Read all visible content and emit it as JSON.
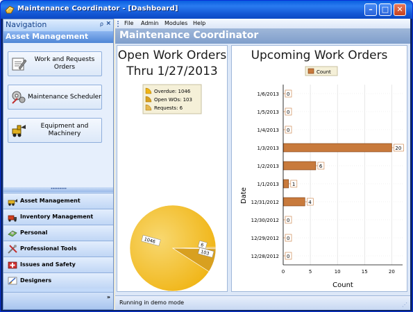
{
  "window": {
    "title": "Maintenance Coordinator - [Dashboard]",
    "minimize_glyph": "–",
    "maximize_glyph": "□",
    "close_glyph": "✕"
  },
  "nav": {
    "title": "Navigation",
    "pin_glyph": "⍴",
    "close_glyph": "×",
    "group_title": "Asset Management",
    "buttons": [
      {
        "label": "Work and Requests Orders",
        "icon": "work-orders-icon"
      },
      {
        "label": "Maintenance Scheduler",
        "icon": "scheduler-icon"
      },
      {
        "label": "Equipment and Machinery",
        "icon": "equipment-icon"
      }
    ],
    "splitter_glyph": "•••••••••",
    "items": [
      {
        "label": "Asset Management",
        "icon": "asset-icon"
      },
      {
        "label": "Inventory Management",
        "icon": "inventory-icon"
      },
      {
        "label": "Personal",
        "icon": "personal-icon"
      },
      {
        "label": "Professional Tools",
        "icon": "tools-icon"
      },
      {
        "label": "Issues and Safety",
        "icon": "safety-icon"
      },
      {
        "label": "Designers",
        "icon": "designers-icon"
      }
    ],
    "footer_chevron": "»"
  },
  "menu": {
    "file": "File",
    "admin": "Admin",
    "modules": "Modules",
    "help": "Help"
  },
  "header": {
    "title": "Maintenance Coordinator"
  },
  "status": {
    "text": "Running in demo mode"
  },
  "colors": {
    "pie_main": "#f0b414",
    "bar_fill": "#c87a3c",
    "accent": "#0a5fe0"
  },
  "chart_data": [
    {
      "type": "pie",
      "title": "Open Work Orders",
      "subtitle": "Thru 1/27/2013",
      "legend": [
        "Overdue: 1046",
        "Open WOs: 103",
        "Requests: 6"
      ],
      "legend_placement": "top",
      "categories": [
        "Overdue",
        "Open WOs",
        "Requests"
      ],
      "values": [
        1046,
        103,
        6
      ],
      "data_labels": [
        "1046",
        "103",
        "6"
      ]
    },
    {
      "type": "bar",
      "orientation": "horizontal",
      "title": "Upcoming Work Orders",
      "legend": [
        "Count"
      ],
      "legend_placement": "top",
      "xlabel": "Count",
      "ylabel": "Date",
      "categories": [
        "1/6/2013",
        "1/5/2013",
        "1/4/2013",
        "1/3/2013",
        "1/2/2013",
        "1/1/2013",
        "12/31/2012",
        "12/30/2012",
        "12/29/2012",
        "12/28/2012"
      ],
      "values": [
        0,
        0,
        0,
        20,
        6,
        1,
        4,
        0,
        0,
        0
      ],
      "xlim": [
        0,
        22
      ],
      "xticks": [
        "0",
        "5",
        "10",
        "15",
        "20"
      ],
      "grid": true
    }
  ]
}
